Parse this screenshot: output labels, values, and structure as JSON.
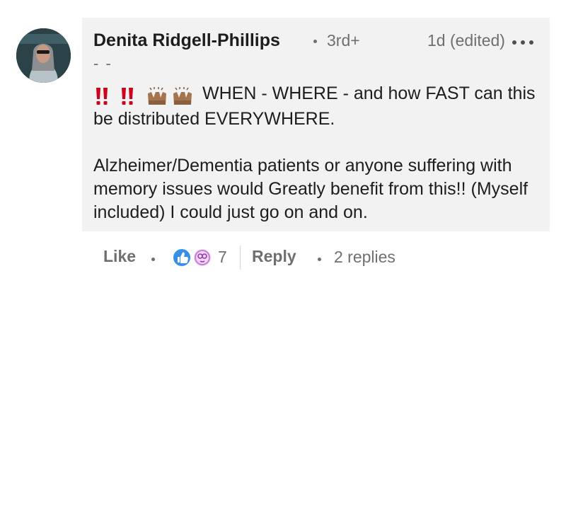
{
  "comment": {
    "author_name": "Denita Ridgell-Phillips",
    "connection_degree": "3rd+",
    "timestamp": "1d (edited)",
    "headline": "- -",
    "body_paragraphs": [
      "WHEN - WHERE - and how FAST can this be distributed EVERYWHERE.",
      "Alzheimer/Dementia patients or anyone suffering with memory issues would Greatly benefit from this!! (Myself included) I could just go on and on."
    ],
    "leading_emojis": [
      "double-exclamation-icon",
      "double-exclamation-icon",
      "raising-hands-icon",
      "raising-hands-icon"
    ],
    "avatar_icon": "profile-photo",
    "more_icon": "more-options-icon"
  },
  "actions": {
    "like_label": "Like",
    "reaction_icons": [
      "like-reaction-icon",
      "curious-reaction-icon"
    ],
    "reaction_count": "7",
    "reply_label": "Reply",
    "replies_label": "2 replies"
  },
  "colors": {
    "bubble_bg": "#f2f2f2",
    "muted_text": "#6f6f6f",
    "like_blue": "#378fe9",
    "curious_purple": "#c87cd6",
    "emoji_red": "#d0021b"
  }
}
